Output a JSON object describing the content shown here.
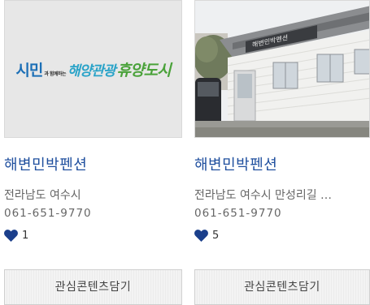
{
  "cards": [
    {
      "image": {
        "kind": "logo",
        "logo_text": {
          "part1": "시민",
          "part2": "과 함께하는",
          "part3": "해양관광",
          "part4": "휴양도시"
        },
        "colors": {
          "bg": "#e7e7e7",
          "blue": "#1c6fb6",
          "teal": "#2aa3c8",
          "green": "#4aa23a"
        }
      },
      "title": "해변민박펜션",
      "address": "전라남도 여수시",
      "phone": "061-651-9770",
      "likes": "1",
      "button_label": "관심콘텐츠담기"
    },
    {
      "image": {
        "kind": "photo",
        "sign_text": "해변민박펜션",
        "colors": {
          "sky": "#eef0f2",
          "wall": "#f1f1ef",
          "roof": "#7b7d80",
          "ground": "#9a9a95"
        }
      },
      "title": "해변민박펜션",
      "address": "전라남도 여수시 만성리길 …",
      "phone": "061-651-9770",
      "likes": "5",
      "button_label": "관심콘텐츠담기"
    }
  ],
  "colors": {
    "title": "#1f4f9e",
    "heart": "#1b3f8b",
    "text": "#666666"
  }
}
